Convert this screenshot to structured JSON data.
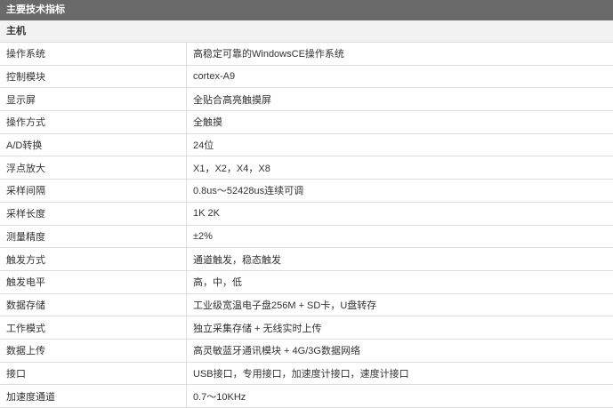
{
  "header": {
    "title": "主要技术指标"
  },
  "section": {
    "label": "主机"
  },
  "rows": [
    {
      "label": "操作系统",
      "value": "高稳定可靠的WindowsCE操作系统"
    },
    {
      "label": "控制模块",
      "value": "cortex-A9"
    },
    {
      "label": "显示屏",
      "value": "全贴合高亮触摸屏"
    },
    {
      "label": "操作方式",
      "value": "全触摸"
    },
    {
      "label": "A/D转换",
      "value": "24位"
    },
    {
      "label": "浮点放大",
      "value": "X1，X2，X4，X8"
    },
    {
      "label": "采样间隔",
      "value": "0.8us～52428us连续可调"
    },
    {
      "label": "采样长度",
      "value": "1K 2K"
    },
    {
      "label": "测量精度",
      "value": "±2%"
    },
    {
      "label": "触发方式",
      "value": "通道触发，稳态触发"
    },
    {
      "label": "触发电平",
      "value": "高，中，低"
    },
    {
      "label": "数据存储",
      "value": "工业级宽温电子盘256M + SD卡，U盘转存"
    },
    {
      "label": "工作模式",
      "value": "独立采集存储 + 无线实时上传"
    },
    {
      "label": "数据上传",
      "value": "高灵敏蓝牙通讯模块 + 4G/3G数据网络"
    },
    {
      "label": "接口",
      "value": "USB接口，专用接口，加速度计接口，速度计接口"
    },
    {
      "label": "加速度通道",
      "value": "0.7～10KHz"
    }
  ]
}
